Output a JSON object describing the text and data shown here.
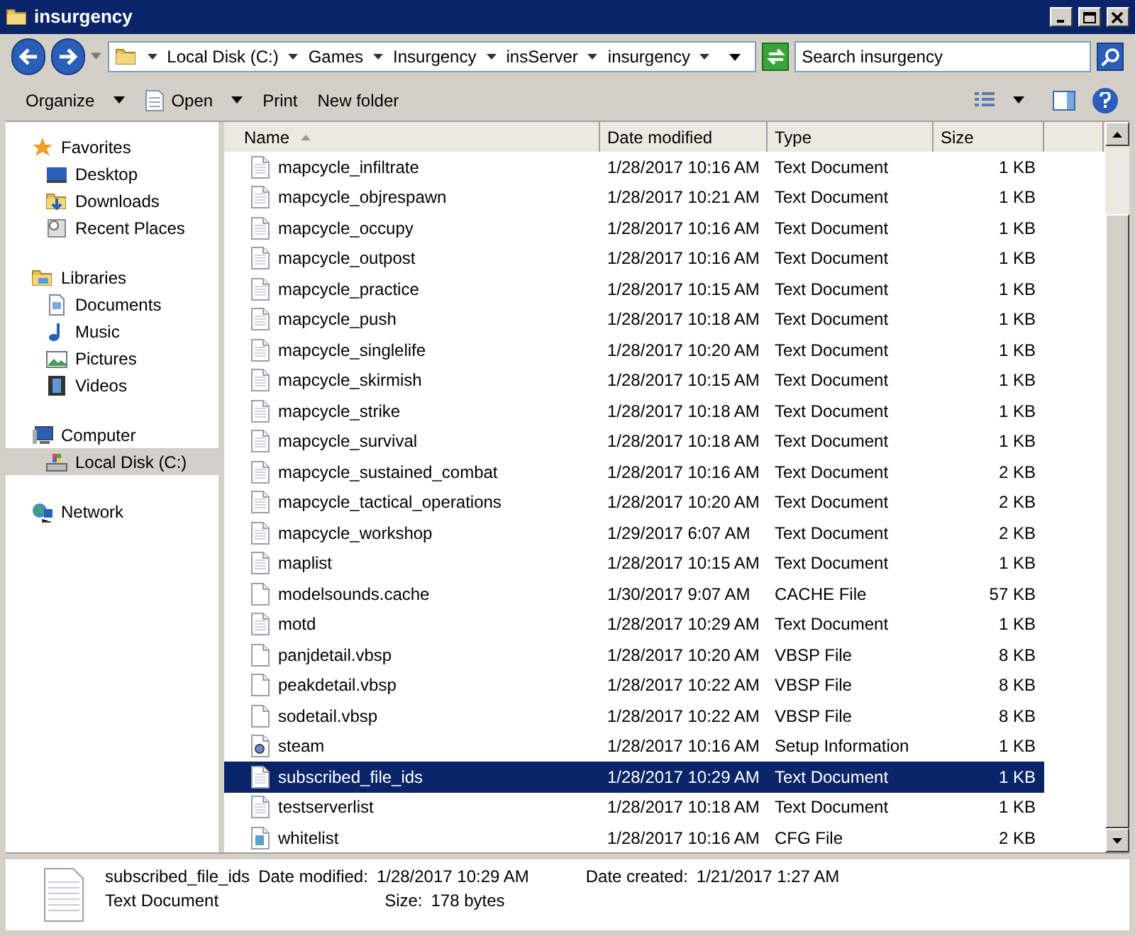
{
  "window": {
    "title": "insurgency"
  },
  "address": {
    "crumbs": [
      "Local Disk (C:)",
      "Games",
      "Insurgency",
      "insServer",
      "insurgency"
    ]
  },
  "search": {
    "placeholder": "Search insurgency"
  },
  "toolbar": [
    {
      "label": "Organize",
      "dropdown": true
    },
    {
      "label": "Open",
      "dropdown": true,
      "kind": "open"
    },
    {
      "label": "Print",
      "dropdown": false
    },
    {
      "label": "New folder",
      "dropdown": false
    }
  ],
  "sidebar": [
    {
      "label": "Favorites",
      "kind": "star",
      "selected": false,
      "children": [
        {
          "label": "Desktop",
          "kind": "desktop",
          "selected": false
        },
        {
          "label": "Downloads",
          "kind": "downloads",
          "selected": false
        },
        {
          "label": "Recent Places",
          "kind": "recent",
          "selected": false
        }
      ]
    },
    {
      "label": "Libraries",
      "kind": "library",
      "selected": false,
      "children": [
        {
          "label": "Documents",
          "kind": "documents",
          "selected": false
        },
        {
          "label": "Music",
          "kind": "music",
          "selected": false
        },
        {
          "label": "Pictures",
          "kind": "pictures",
          "selected": false
        },
        {
          "label": "Videos",
          "kind": "videos",
          "selected": false
        }
      ]
    },
    {
      "label": "Computer",
      "kind": "computer",
      "selected": false,
      "children": [
        {
          "label": "Local Disk (C:)",
          "kind": "disk",
          "selected": true
        }
      ]
    },
    {
      "label": "Network",
      "kind": "network",
      "selected": false
    }
  ],
  "table": {
    "columns": [
      "Name",
      "Date modified",
      "Type",
      "Size"
    ],
    "rows": [
      {
        "name": "mapcycle_infiltrate",
        "date": "1/28/2017 10:16 AM",
        "type": "Text Document",
        "size": "1 KB",
        "kind": "text",
        "selected": false
      },
      {
        "name": "mapcycle_objrespawn",
        "date": "1/28/2017 10:21 AM",
        "type": "Text Document",
        "size": "1 KB",
        "kind": "text",
        "selected": false
      },
      {
        "name": "mapcycle_occupy",
        "date": "1/28/2017 10:16 AM",
        "type": "Text Document",
        "size": "1 KB",
        "kind": "text",
        "selected": false
      },
      {
        "name": "mapcycle_outpost",
        "date": "1/28/2017 10:16 AM",
        "type": "Text Document",
        "size": "1 KB",
        "kind": "text",
        "selected": false
      },
      {
        "name": "mapcycle_practice",
        "date": "1/28/2017 10:15 AM",
        "type": "Text Document",
        "size": "1 KB",
        "kind": "text",
        "selected": false
      },
      {
        "name": "mapcycle_push",
        "date": "1/28/2017 10:18 AM",
        "type": "Text Document",
        "size": "1 KB",
        "kind": "text",
        "selected": false
      },
      {
        "name": "mapcycle_singlelife",
        "date": "1/28/2017 10:20 AM",
        "type": "Text Document",
        "size": "1 KB",
        "kind": "text",
        "selected": false
      },
      {
        "name": "mapcycle_skirmish",
        "date": "1/28/2017 10:15 AM",
        "type": "Text Document",
        "size": "1 KB",
        "kind": "text",
        "selected": false
      },
      {
        "name": "mapcycle_strike",
        "date": "1/28/2017 10:18 AM",
        "type": "Text Document",
        "size": "1 KB",
        "kind": "text",
        "selected": false
      },
      {
        "name": "mapcycle_survival",
        "date": "1/28/2017 10:18 AM",
        "type": "Text Document",
        "size": "1 KB",
        "kind": "text",
        "selected": false
      },
      {
        "name": "mapcycle_sustained_combat",
        "date": "1/28/2017 10:16 AM",
        "type": "Text Document",
        "size": "2 KB",
        "kind": "text",
        "selected": false
      },
      {
        "name": "mapcycle_tactical_operations",
        "date": "1/28/2017 10:20 AM",
        "type": "Text Document",
        "size": "2 KB",
        "kind": "text",
        "selected": false
      },
      {
        "name": "mapcycle_workshop",
        "date": "1/29/2017 6:07 AM",
        "type": "Text Document",
        "size": "2 KB",
        "kind": "text",
        "selected": false
      },
      {
        "name": "maplist",
        "date": "1/28/2017 10:15 AM",
        "type": "Text Document",
        "size": "1 KB",
        "kind": "text",
        "selected": false
      },
      {
        "name": "modelsounds.cache",
        "date": "1/30/2017 9:07 AM",
        "type": "CACHE File",
        "size": "57 KB",
        "kind": "blank",
        "selected": false
      },
      {
        "name": "motd",
        "date": "1/28/2017 10:29 AM",
        "type": "Text Document",
        "size": "1 KB",
        "kind": "text",
        "selected": false
      },
      {
        "name": "panjdetail.vbsp",
        "date": "1/28/2017 10:20 AM",
        "type": "VBSP File",
        "size": "8 KB",
        "kind": "blank",
        "selected": false
      },
      {
        "name": "peakdetail.vbsp",
        "date": "1/28/2017 10:22 AM",
        "type": "VBSP File",
        "size": "8 KB",
        "kind": "blank",
        "selected": false
      },
      {
        "name": "sodetail.vbsp",
        "date": "1/28/2017 10:22 AM",
        "type": "VBSP File",
        "size": "8 KB",
        "kind": "blank",
        "selected": false
      },
      {
        "name": "steam",
        "date": "1/28/2017 10:16 AM",
        "type": "Setup Information",
        "size": "1 KB",
        "kind": "setup",
        "selected": false
      },
      {
        "name": "subscribed_file_ids",
        "date": "1/28/2017 10:29 AM",
        "type": "Text Document",
        "size": "1 KB",
        "kind": "text",
        "selected": true
      },
      {
        "name": "testserverlist",
        "date": "1/28/2017 10:18 AM",
        "type": "Text Document",
        "size": "1 KB",
        "kind": "text",
        "selected": false
      },
      {
        "name": "whitelist",
        "date": "1/28/2017 10:16 AM",
        "type": "CFG File",
        "size": "2 KB",
        "kind": "cfg",
        "selected": false
      }
    ]
  },
  "details": {
    "name": "subscribed_file_ids",
    "type": "Text Document",
    "fields": [
      {
        "label": "Date modified:",
        "value": "1/28/2017 10:29 AM"
      },
      {
        "label": "Size:",
        "value": "178 bytes"
      },
      {
        "label": "Date created:",
        "value": "1/21/2017 1:27 AM"
      }
    ]
  }
}
